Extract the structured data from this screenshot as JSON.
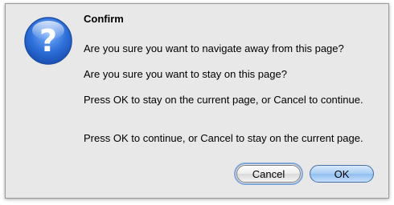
{
  "dialog": {
    "title": "Confirm",
    "messages": [
      "Are you sure you want to navigate away from this page?",
      "Are you sure you want to stay on this page?",
      "Press OK to stay on the current page, or Cancel to continue.",
      "Press OK to continue, or Cancel to stay on the current page."
    ],
    "icon": "question-icon",
    "buttons": {
      "cancel": "Cancel",
      "ok": "OK"
    }
  },
  "colors": {
    "dialog_bg": "#e8e8e8",
    "icon_blue": "#2d6fd8",
    "ok_blue": "#a8cdf3"
  }
}
